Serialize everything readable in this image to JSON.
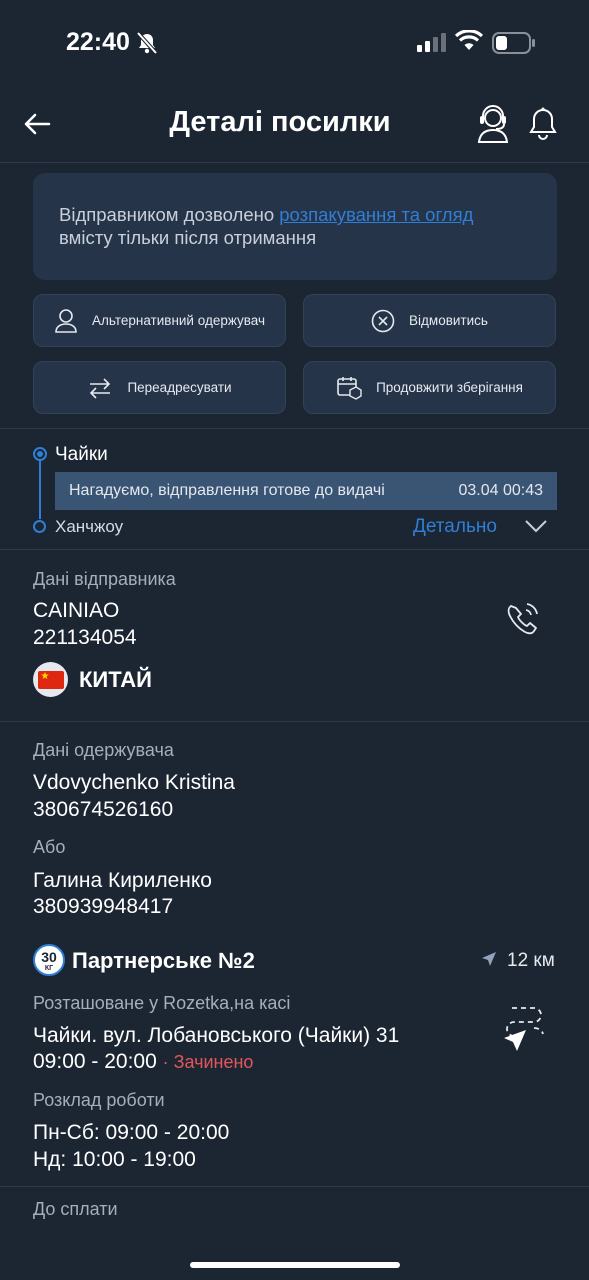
{
  "status_bar": {
    "time": "22:40"
  },
  "header": {
    "title": "Деталі посилки"
  },
  "info_card": {
    "text_before": "Відправником дозволено ",
    "link": "розпакування та огляд",
    "text_after": " вмісту тільки після отримання"
  },
  "actions": {
    "alt_recipient": "Альтернативний одержувач",
    "refuse": "Відмовитись",
    "redirect": "Переадресувати",
    "extend_storage": "Продовжити зберігання"
  },
  "route": {
    "from": "Чайки",
    "notice": "Нагадуємо, відправлення готове до видачі",
    "notice_time": "03.04 00:43",
    "to": "Ханчжоу",
    "details": "Детально"
  },
  "sender": {
    "label": "Дані відправника",
    "name": "CAINIAO",
    "phone": "221134054",
    "country": "КИТАЙ"
  },
  "recipient": {
    "label": "Дані одержувача",
    "name": "Vdovychenko Kristina",
    "phone": "380674526160",
    "or": "Або",
    "alt_name": "Галина Кириленко",
    "alt_phone": "380939948417"
  },
  "branch": {
    "weight_limit": "30",
    "weight_unit": "КГ",
    "name": "Партнерське №2",
    "distance": "12 км",
    "location_note": "Розташоване у Rozetka,на касі",
    "address": "Чайки. вул. Лобановського (Чайки) 31",
    "hours_today": "09:00 - 20:00",
    "status": "· Зачинено",
    "schedule_label": "Розклад роботи",
    "schedule_weekdays": "Пн-Сб: 09:00 - 20:00",
    "schedule_sunday": "Нд: 10:00 - 19:00"
  },
  "payment": {
    "label": "До сплати"
  },
  "colors": {
    "background": "#1c2532",
    "card": "#26344a",
    "accent": "#2f7fd6",
    "closed": "#e5565c"
  }
}
